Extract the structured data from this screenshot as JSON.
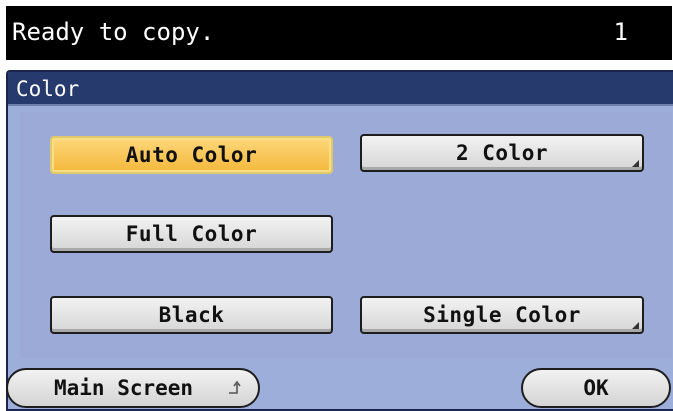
{
  "status": {
    "message": "Ready to copy.",
    "copy_count": "1"
  },
  "panel": {
    "title": "Color"
  },
  "options": {
    "auto_color": "Auto Color",
    "two_color": "2 Color",
    "full_color": "Full Color",
    "black": "Black",
    "single_color": "Single Color"
  },
  "selected_option": "Auto Color",
  "footer": {
    "main_screen": "Main Screen",
    "ok": "OK"
  },
  "colors": {
    "status_bar_bg": "#000000",
    "header_bg": "#263a6e",
    "panel_bg": "#9caad7",
    "selected_bg": "#f3b83b",
    "button_bg": "#e6e6e6"
  },
  "icons": {
    "more_options": "corner-triangle-icon",
    "return": "return-arrow-icon"
  }
}
